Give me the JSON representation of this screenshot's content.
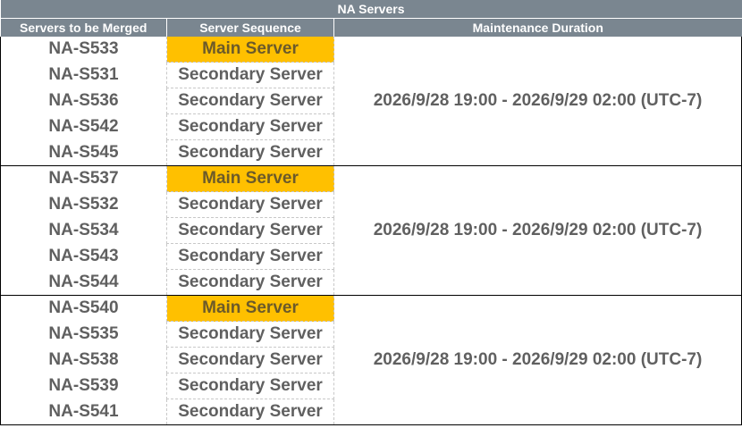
{
  "table": {
    "title": "NA Servers",
    "headers": {
      "col1": "Servers to be Merged",
      "col2": "Server Sequence",
      "col3": "Maintenance Duration"
    },
    "colors": {
      "header_bg": "#7a8690",
      "main_highlight": "#ffc000",
      "text": "#606060"
    },
    "groups": [
      {
        "duration": "2026/9/28 19:00 - 2026/9/29 02:00 (UTC-7)",
        "rows": [
          {
            "server": "NA-S533",
            "sequence": "Main Server"
          },
          {
            "server": "NA-S531",
            "sequence": "Secondary Server"
          },
          {
            "server": "NA-S536",
            "sequence": "Secondary Server"
          },
          {
            "server": "NA-S542",
            "sequence": "Secondary Server"
          },
          {
            "server": "NA-S545",
            "sequence": "Secondary Server"
          }
        ]
      },
      {
        "duration": "2026/9/28 19:00 - 2026/9/29 02:00 (UTC-7)",
        "rows": [
          {
            "server": "NA-S537",
            "sequence": "Main Server"
          },
          {
            "server": "NA-S532",
            "sequence": "Secondary Server"
          },
          {
            "server": "NA-S534",
            "sequence": "Secondary Server"
          },
          {
            "server": "NA-S543",
            "sequence": "Secondary Server"
          },
          {
            "server": "NA-S544",
            "sequence": "Secondary Server"
          }
        ]
      },
      {
        "duration": "2026/9/28 19:00 - 2026/9/29 02:00 (UTC-7)",
        "rows": [
          {
            "server": "NA-S540",
            "sequence": "Main Server"
          },
          {
            "server": "NA-S535",
            "sequence": "Secondary Server"
          },
          {
            "server": "NA-S538",
            "sequence": "Secondary Server"
          },
          {
            "server": "NA-S539",
            "sequence": "Secondary Server"
          },
          {
            "server": "NA-S541",
            "sequence": "Secondary Server"
          }
        ]
      }
    ]
  }
}
